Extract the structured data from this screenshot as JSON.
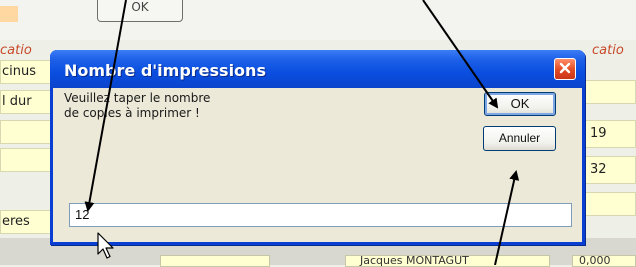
{
  "background": {
    "ok_button_label": "OK",
    "left_row_labels": [
      "cinus",
      "l dur",
      "",
      "",
      "eres"
    ],
    "left_header_label": "catio",
    "right_header_label": "catio",
    "right_values": [
      "19",
      "32"
    ],
    "bottom_name": "Jacques MONTAGUT",
    "bottom_value": "0,000"
  },
  "dialog": {
    "title": "Nombre d'impressions",
    "prompt": "Veuillez taper le nombre\nde copies à imprimer !",
    "ok_label": "OK",
    "cancel_label": "Annuler",
    "input_value": "12"
  },
  "icons": {
    "close": "close-icon",
    "cursor": "mouse-pointer-icon"
  },
  "colors": {
    "title_bar": "#0a4ee0",
    "close_button": "#e24a22",
    "annotation_arrows": "#000000",
    "field_background": "#ffffd2"
  }
}
